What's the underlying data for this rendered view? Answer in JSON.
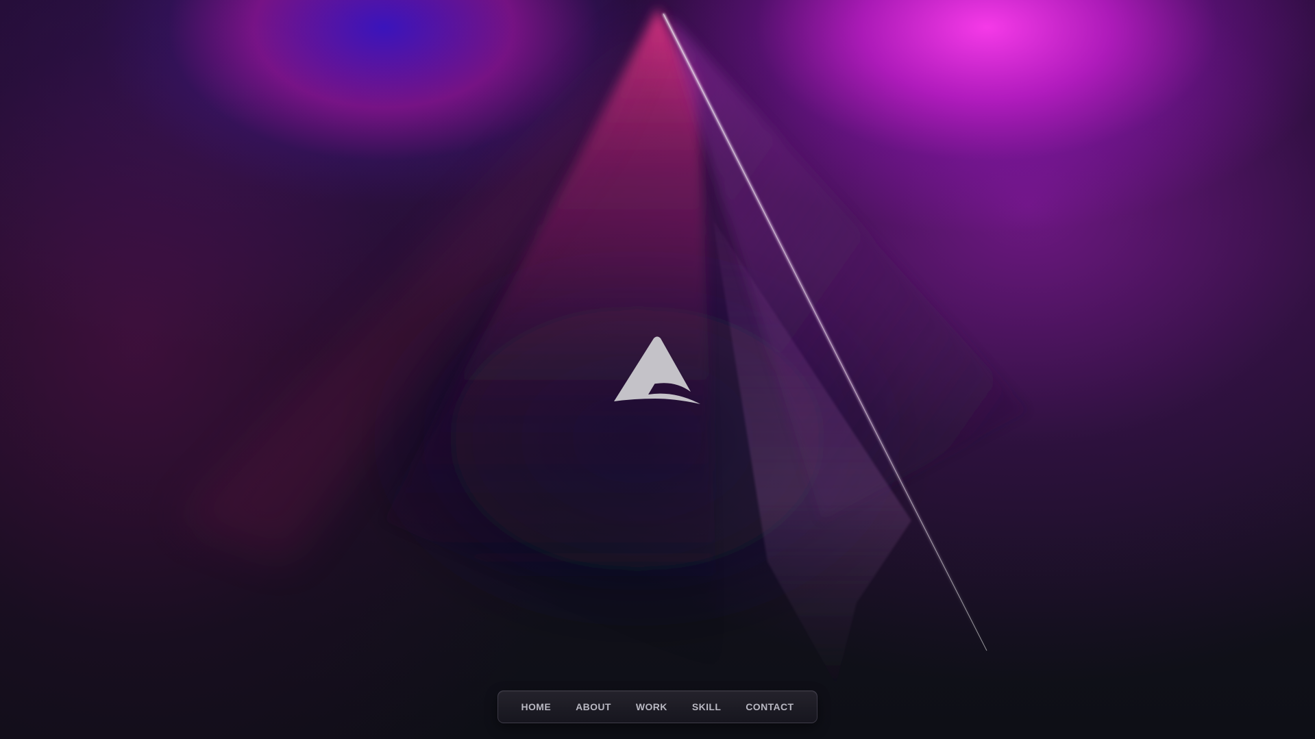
{
  "nav": {
    "items": [
      {
        "label": "HOME"
      },
      {
        "label": "ABOUT"
      },
      {
        "label": "WORK"
      },
      {
        "label": "SKILL"
      },
      {
        "label": "CONTACT"
      }
    ]
  },
  "logo": {
    "icon": "triangle-a-logo-icon",
    "color": "#c4c2c8"
  },
  "colors": {
    "background_dark": "#0e0f17",
    "magenta_glow": "#ee33ee",
    "violet_glow": "#3a1cc8",
    "nav_text": "#b9b8c2"
  }
}
